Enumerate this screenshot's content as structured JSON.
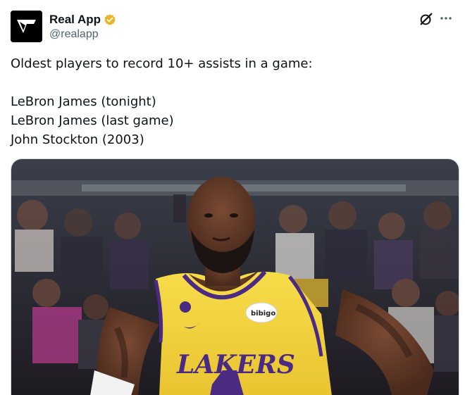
{
  "post": {
    "display_name": "Real App",
    "handle": "@realapp",
    "verified_color": "#e8b52a",
    "text_lines": [
      "Oldest players to record 10+ assists in a game:",
      "",
      "LeBron James (tonight)",
      "LeBron James (last game)",
      "John Stockton (2003)"
    ]
  },
  "actions": {
    "grok_icon": "grok-slash-circle-icon",
    "more_icon": "ellipsis-icon"
  },
  "media": {
    "jersey_text": "LAKERS",
    "patch_text": "bibigo",
    "jersey_color": "#f4d43c",
    "jersey_trim": "#4b2a84"
  }
}
